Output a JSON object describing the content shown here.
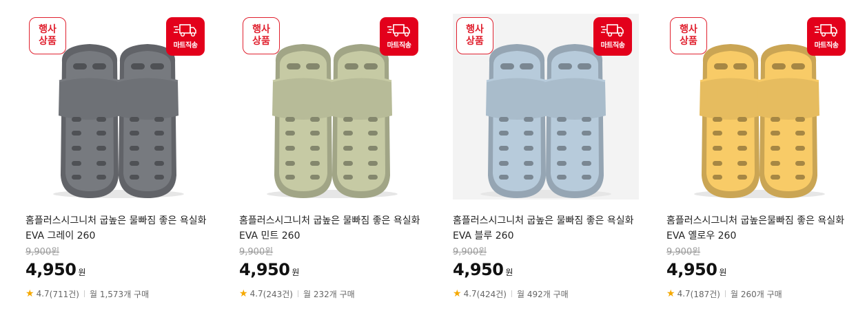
{
  "badges": {
    "event_line1": "행사",
    "event_line2": "상품",
    "mart": "마트직송"
  },
  "products": [
    {
      "title_line1": "홈플러스시그니처 굽높은 물빠짐 좋은 욕실화",
      "title_line2": "EVA 그레이 260",
      "original_price": "9,900원",
      "sale_price": "4,950",
      "currency": "원",
      "rating": "4.7",
      "review_count": "711건",
      "monthly_sales": "월 1,573개 구매",
      "color": "#6e7176"
    },
    {
      "title_line1": "홈플러스시그니처 굽높은 물빠짐 좋은 욕실화",
      "title_line2": "EVA 민트 260",
      "original_price": "9,900원",
      "sale_price": "4,950",
      "currency": "원",
      "rating": "4.7",
      "review_count": "243건",
      "monthly_sales": "월 232개 구매",
      "color": "#b7bb98"
    },
    {
      "title_line1": "홈플러스시그니처 굽높은 물빠짐 좋은 욕실화",
      "title_line2": "EVA 블루 260",
      "original_price": "9,900원",
      "sale_price": "4,950",
      "currency": "원",
      "rating": "4.7",
      "review_count": "424건",
      "monthly_sales": "월 492개 구매",
      "color": "#a9bccb"
    },
    {
      "title_line1": "홈플러스시그니처 굽높은물빠짐 좋은 욕실화",
      "title_line2": "EVA 옐로우 260",
      "original_price": "9,900원",
      "sale_price": "4,950",
      "currency": "원",
      "rating": "4.7",
      "review_count": "187건",
      "monthly_sales": "월 260개 구매",
      "color": "#e6bc5f"
    }
  ]
}
